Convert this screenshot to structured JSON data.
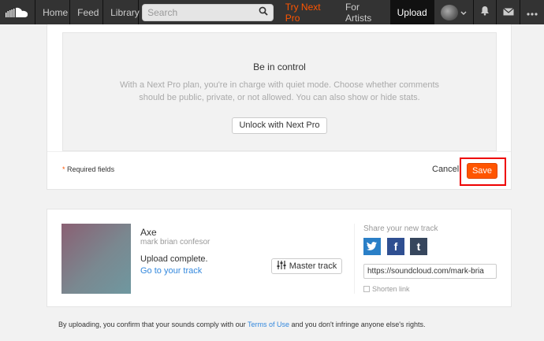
{
  "nav": {
    "home": "Home",
    "feed": "Feed",
    "library": "Library",
    "search_placeholder": "Search",
    "try_pro": "Try Next Pro",
    "for_artists": "For Artists",
    "upload": "Upload",
    "icons": [
      "soundcloud-logo-icon",
      "search-icon",
      "chevron-down-icon",
      "bell-icon",
      "envelope-icon",
      "more-icon"
    ]
  },
  "pro_panel": {
    "title": "Be in control",
    "description": "With a Next Pro plan, you're in charge with quiet mode. Choose whether comments should be public, private, or not allowed. You can also show or hide stats.",
    "unlock_label": "Unlock with Next Pro"
  },
  "form_footer": {
    "required_star": "*",
    "required_label": "Required fields",
    "cancel_label": "Cancel",
    "save_label": "Save"
  },
  "track": {
    "title": "Axe",
    "artist": "mark brian confesor",
    "status": "Upload complete.",
    "go_link": "Go to your track",
    "master_label": "Master track"
  },
  "share": {
    "title": "Share your new track",
    "twitter": "t",
    "facebook": "f",
    "tumblr": "t",
    "url": "https://soundcloud.com/mark-bria",
    "shorten_label": "Shorten link"
  },
  "footer": {
    "pre": "By uploading, you confirm that your sounds comply with our ",
    "link": "Terms of Use",
    "post": " and you don't infringe anyone else's rights."
  },
  "colors": {
    "accent": "#ff5500",
    "highlight": "#ee0000",
    "link": "#3388dd",
    "navbar": "#333333"
  }
}
